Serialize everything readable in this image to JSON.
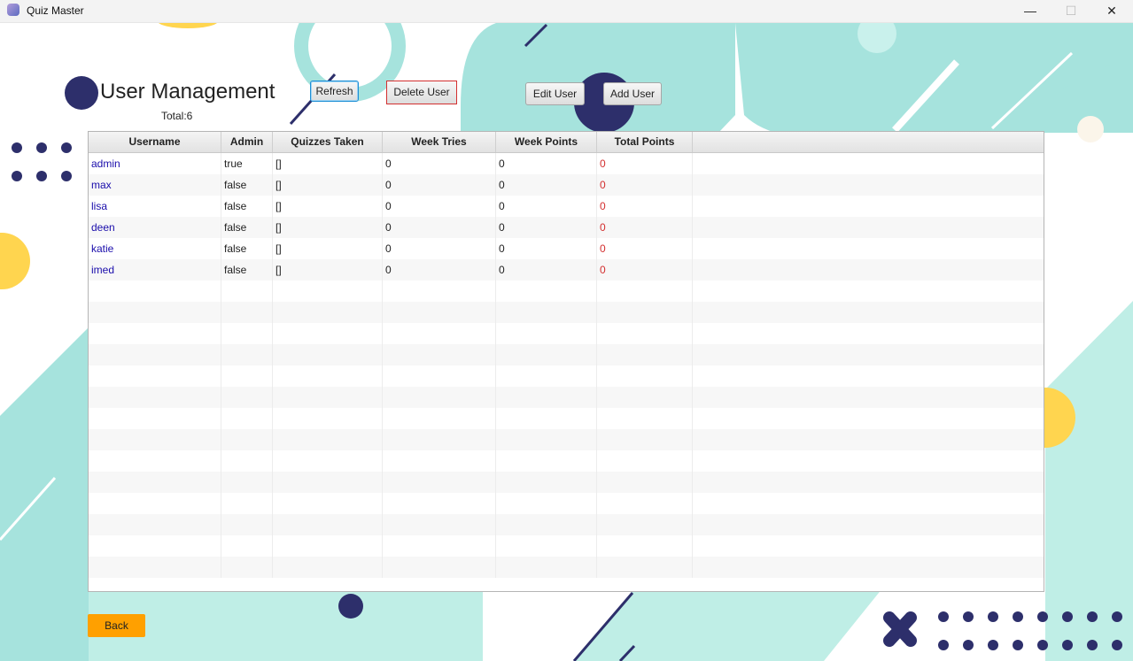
{
  "window": {
    "title": "Quiz Master",
    "minimize": "—",
    "maximize": "☐",
    "close": "✕"
  },
  "header": {
    "title": "User Management",
    "total": "Total:6"
  },
  "toolbar": {
    "refresh": "Refresh",
    "delete": "Delete User",
    "edit": "Edit User",
    "add": "Add User"
  },
  "table": {
    "columns": [
      "Username",
      "Admin",
      "Quizzes Taken",
      "Week Tries",
      "Week Points",
      "Total Points"
    ],
    "rows": [
      [
        "admin",
        "true",
        "[]",
        "0",
        "0",
        "0"
      ],
      [
        "max",
        "false",
        "[]",
        "0",
        "0",
        "0"
      ],
      [
        "lisa",
        "false",
        "[]",
        "0",
        "0",
        "0"
      ],
      [
        "deen",
        "false",
        "[]",
        "0",
        "0",
        "0"
      ],
      [
        "katie",
        "false",
        "[]",
        "0",
        "0",
        "0"
      ],
      [
        "imed",
        "false",
        "[]",
        "0",
        "0",
        "0"
      ]
    ]
  },
  "footer": {
    "back": "Back"
  },
  "colors": {
    "teal": "#a6e3dd",
    "navy": "#2d2f6b",
    "yellow": "#ffd54f",
    "back_button": "#ffa000",
    "delete_border": "#d32f2f",
    "points_text": "#d32f2f",
    "username_text": "#1a0dab"
  }
}
